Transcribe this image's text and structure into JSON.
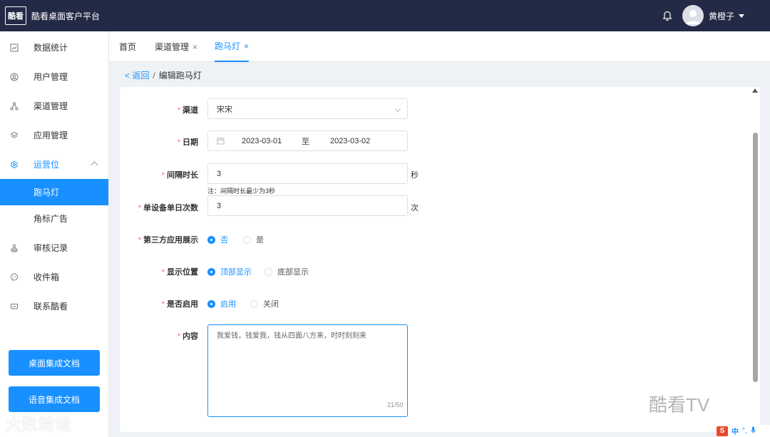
{
  "header": {
    "logo_text": "酷看",
    "app_title": "酷看桌面客户平台",
    "username": "黄橙子"
  },
  "sidebar": {
    "items": [
      {
        "label": "数据统计",
        "icon": "chart-icon"
      },
      {
        "label": "用户管理",
        "icon": "user-icon"
      },
      {
        "label": "渠道管理",
        "icon": "network-icon"
      },
      {
        "label": "应用管理",
        "icon": "layers-icon"
      },
      {
        "label": "运营位",
        "icon": "operation-icon"
      }
    ],
    "sub_items": [
      {
        "label": "跑马灯"
      },
      {
        "label": "角标广告"
      }
    ],
    "items_after": [
      {
        "label": "审核记录",
        "icon": "stamp-icon"
      },
      {
        "label": "收件箱",
        "icon": "message-icon"
      },
      {
        "label": "联系酷看",
        "icon": "chat-icon"
      }
    ],
    "doc_buttons": [
      "桌面集成文档",
      "语音集成文档"
    ]
  },
  "tabs": [
    {
      "label": "首页",
      "closable": false
    },
    {
      "label": "渠道管理",
      "closable": true
    },
    {
      "label": "跑马灯",
      "closable": true
    }
  ],
  "breadcrumb": {
    "back": "< 返回",
    "separator": "/",
    "current": "编辑跑马灯"
  },
  "form": {
    "channel": {
      "label": "渠道",
      "value": "宋宋"
    },
    "date": {
      "label": "日期",
      "start": "2023-03-01",
      "separator": "至",
      "end": "2023-03-02"
    },
    "interval": {
      "label": "间隔时长",
      "value": "3",
      "unit": "秒",
      "hint": "注：间隔时长最少为3秒"
    },
    "daily_count": {
      "label": "单设备单日次数",
      "value": "3",
      "unit": "次"
    },
    "third_party": {
      "label": "第三方应用展示",
      "options": [
        "否",
        "是"
      ],
      "selected": "否"
    },
    "position": {
      "label": "显示位置",
      "options": [
        "顶部显示",
        "底部显示"
      ],
      "selected": "顶部显示"
    },
    "enabled": {
      "label": "是否启用",
      "options": [
        "启用",
        "关闭"
      ],
      "selected": "启用"
    },
    "content": {
      "label": "内容",
      "value": "我爱钱，钱爱我，钱从四面八方来，时时刻刻来",
      "counter": "21/50"
    }
  },
  "watermarks": {
    "left": "大数跨境",
    "right": "酷看TV",
    "ime": "中"
  },
  "colors": {
    "header_bg": "#232a45",
    "accent": "#1890ff",
    "required": "#f56c6c"
  }
}
